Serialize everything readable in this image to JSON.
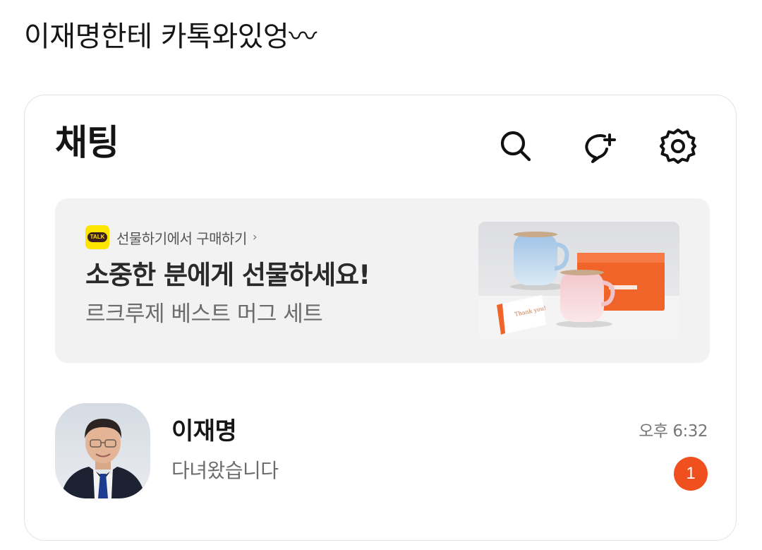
{
  "post": {
    "caption": "이재명한테 카톡와있엉〰"
  },
  "header": {
    "title": "채팅",
    "icons": [
      "search-icon",
      "new-chat-icon",
      "settings-icon"
    ]
  },
  "banner": {
    "badge_text": "TALK",
    "link_text": "선물하기에서 구매하기",
    "link_arrow": "›",
    "title": "소중한 분에게 선물하세요!",
    "subtitle": "르크루제 베스트 머그 세트",
    "product_card_text": "Thank you!"
  },
  "chat": {
    "name": "이재명",
    "preview": "다녀왔습니다",
    "time": "오후 6:32",
    "unread": "1"
  },
  "colors": {
    "talk_yellow": "#fee500",
    "unread_badge": "#f04f1e",
    "banner_bg": "#f2f2f2",
    "gift_box": "#f0642a"
  }
}
